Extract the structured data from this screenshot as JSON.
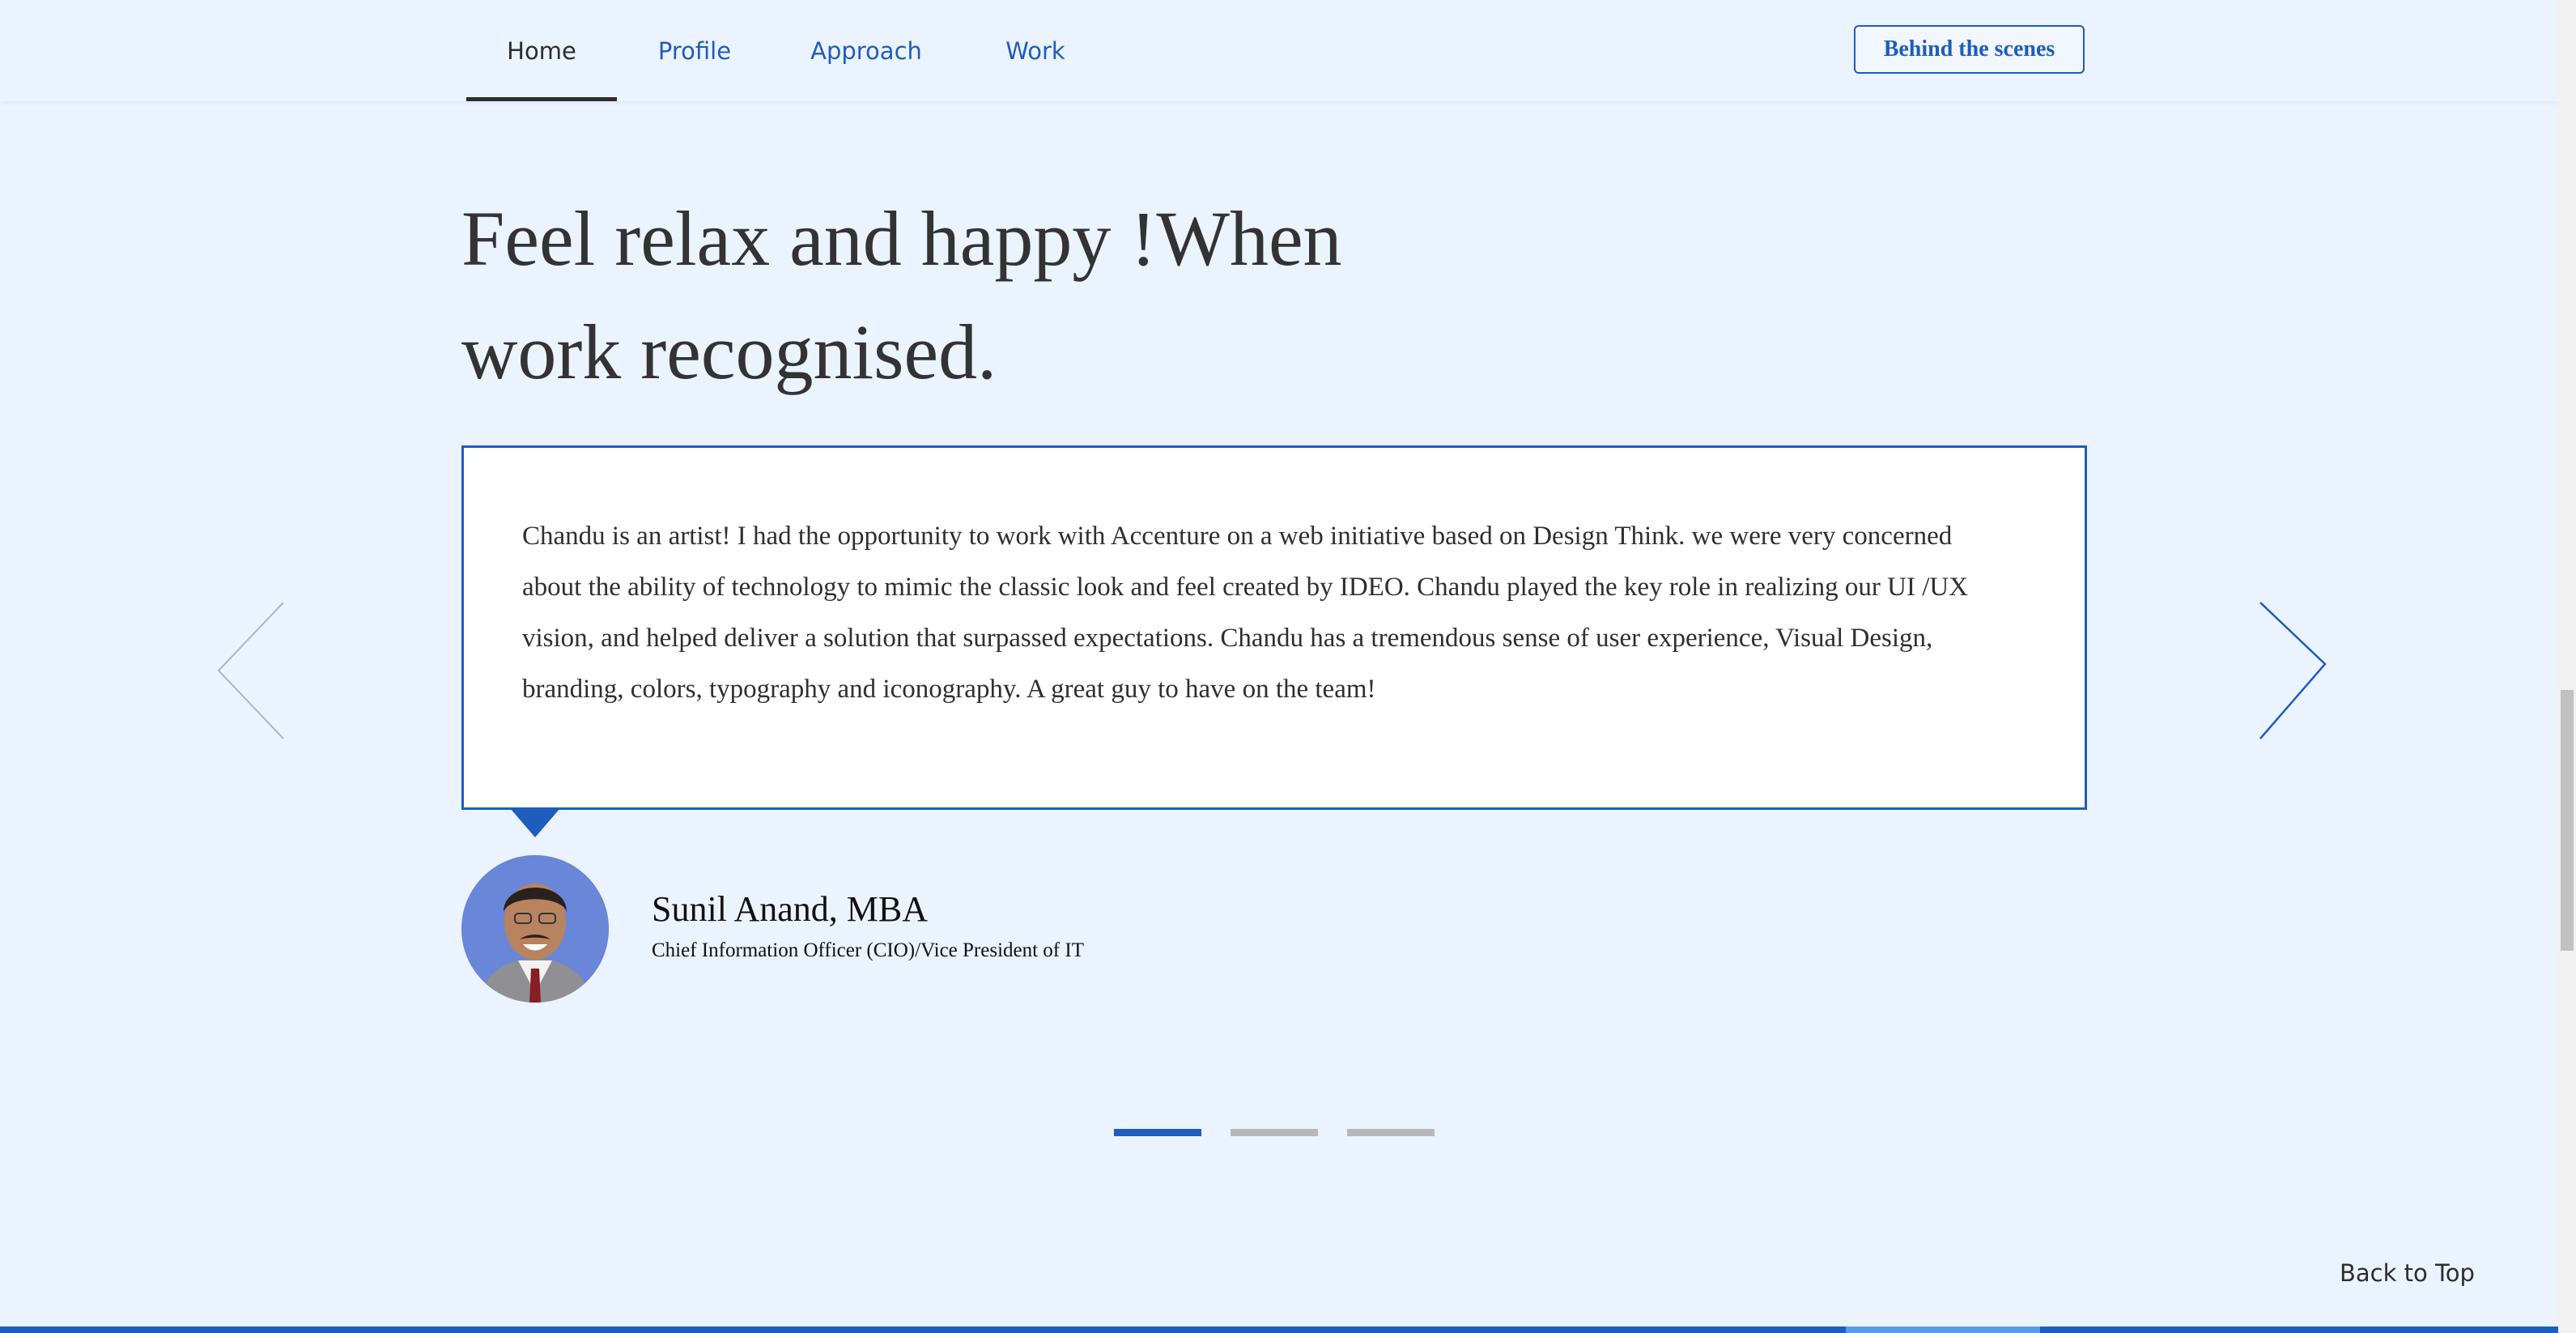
{
  "nav": {
    "items": [
      {
        "label": "Home",
        "active": true
      },
      {
        "label": "Profile",
        "active": false
      },
      {
        "label": "Approach",
        "active": false
      },
      {
        "label": "Work",
        "active": false
      }
    ],
    "cta_label": "Behind the scenes"
  },
  "headline": {
    "line1": "Feel relax and happy !When",
    "line2": "work recognised."
  },
  "testimonial": {
    "quote": "Chandu is an artist! I had the opportunity to work with Accenture on a web initiative based on Design Think. we were very concerned about the ability of technology to mimic the classic look and feel created by IDEO. Chandu played the key role in realizing our UI /UX vision, and helped deliver a solution that surpassed expectations. Chandu has a tremendous sense of user experience, Visual Design, branding, colors, typography and iconography. A great guy to have on the team!",
    "author_name": "Sunil Anand, MBA",
    "author_title": "Chief Information Officer (CIO)/Vice President of IT"
  },
  "carousel": {
    "slide_count": 3,
    "active_index": 0
  },
  "footer": {
    "back_to_top_label": "Back to Top"
  },
  "colors": {
    "background": "#ebf3ff",
    "accent": "#1e5dbd",
    "text_dark": "#333333",
    "dot_inactive": "#b7b8ba"
  },
  "icons": {
    "prev": "chevron-left-icon",
    "next": "chevron-right-icon"
  }
}
